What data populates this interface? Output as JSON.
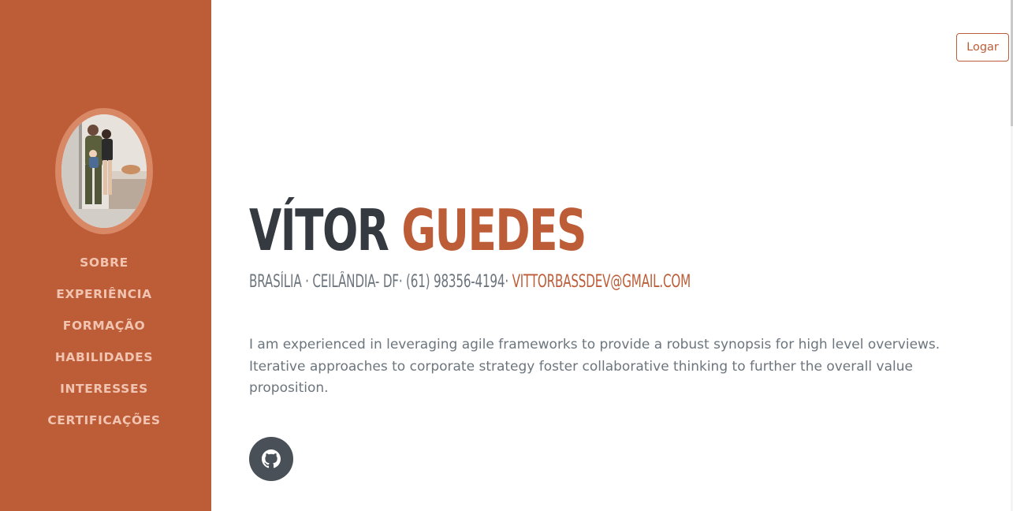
{
  "sidebar": {
    "accent_color": "#bd5d38",
    "avatar_alt": "profile photo",
    "nav_items": [
      {
        "label": "SOBRE"
      },
      {
        "label": "EXPERIÊNCIA"
      },
      {
        "label": "FORMAÇÃO"
      },
      {
        "label": "HABILIDADES"
      },
      {
        "label": "INTERESSES"
      },
      {
        "label": "CERTIFICAÇÕES"
      }
    ]
  },
  "header": {
    "login_label": "Logar"
  },
  "about": {
    "first_name": "VÍTOR",
    "last_name": "GUEDES",
    "location": "BRASÍLIA · CEILÂNDIA- DF· (61) 98356-4194·",
    "email": "VITTORBASSDEV@GMAIL.COM",
    "bio": "I am experienced in leveraging agile frameworks to provide a robust synopsis for high level overviews. Iterative approaches to corporate strategy foster collaborative thinking to further the overall value proposition.",
    "social": [
      {
        "icon": "github-icon"
      }
    ]
  }
}
